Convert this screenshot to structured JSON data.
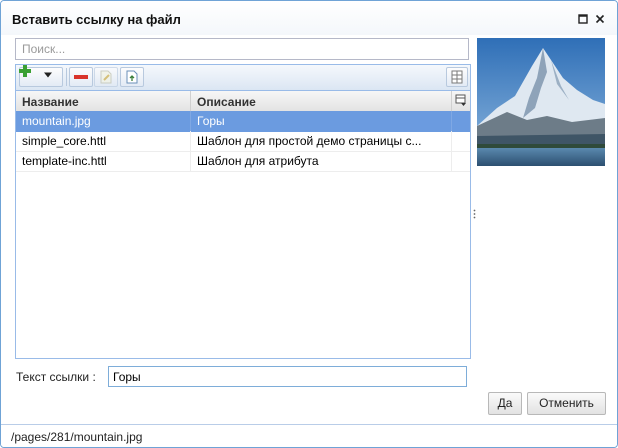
{
  "dialog": {
    "title": "Вставить ссылку на файл"
  },
  "search": {
    "placeholder": "Поиск..."
  },
  "toolbar": {
    "add": "plus-icon",
    "dropdown": "chevron-down-icon",
    "remove": "minus-icon",
    "edit": "edit-file-icon",
    "upload": "upload-file-icon",
    "columns": "columns-icon"
  },
  "table": {
    "columns": [
      "Название",
      "Описание"
    ],
    "rows": [
      {
        "name": "mountain.jpg",
        "description": "Горы",
        "selected": true
      },
      {
        "name": "simple_core.httl",
        "description": "Шаблон для простой демо страницы с...",
        "selected": false
      },
      {
        "name": "template-inc.httl",
        "description": "Шаблон для атрибута",
        "selected": false
      }
    ]
  },
  "link": {
    "label": "Текст ссылки :",
    "value": "Горы"
  },
  "buttons": {
    "ok": "Да",
    "cancel": "Отменить"
  },
  "status": {
    "path": "/pages/281/mountain.jpg"
  },
  "colors": {
    "accent": "#6b9be0",
    "border": "#99bbe8",
    "add_green": "#3aa033",
    "remove_red": "#d9342b"
  }
}
